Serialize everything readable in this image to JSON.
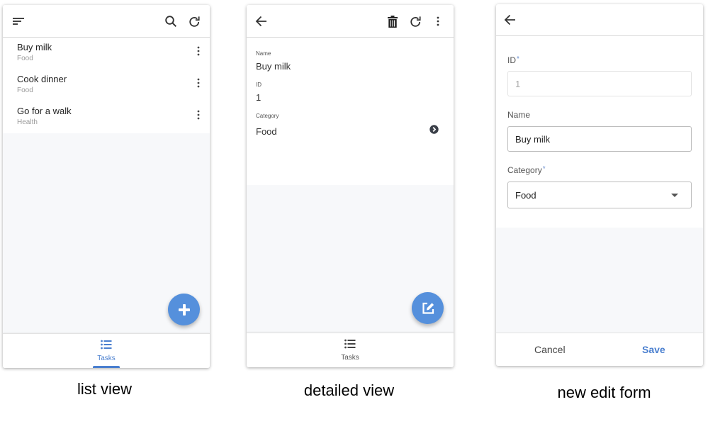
{
  "colors": {
    "accent": "#5590dc",
    "tab_active": "#4a7fcf"
  },
  "list_view": {
    "caption": "list view",
    "toolbar": {
      "icons": [
        "sort-icon",
        "search-icon",
        "refresh-icon"
      ]
    },
    "items": [
      {
        "title": "Buy milk",
        "category": "Food"
      },
      {
        "title": "Cook dinner",
        "category": "Food"
      },
      {
        "title": "Go for a walk",
        "category": "Health"
      }
    ],
    "fab_icon": "plus-icon",
    "bottom_nav": {
      "tab_label": "Tasks",
      "tab_icon": "list-icon",
      "active": true
    }
  },
  "detail_view": {
    "caption": "detailed view",
    "toolbar": {
      "icons": [
        "back-arrow-icon",
        "trash-icon",
        "refresh-icon",
        "more-vertical-icon"
      ]
    },
    "fields": [
      {
        "label": "Name",
        "value": "Buy milk"
      },
      {
        "label": "ID",
        "value": "1"
      },
      {
        "label": "Category",
        "value": "Food"
      }
    ],
    "fab_icon": "edit-icon",
    "bottom_nav": {
      "tab_label": "Tasks",
      "tab_icon": "list-icon",
      "active": false
    }
  },
  "edit_form": {
    "caption": "new edit form",
    "toolbar": {
      "icons": [
        "back-arrow-icon"
      ]
    },
    "id_field": {
      "label": "ID",
      "required_mark": "*",
      "value": "1",
      "disabled": true
    },
    "name_field": {
      "label": "Name",
      "value": "Buy milk"
    },
    "category_field": {
      "label": "Category",
      "required_mark": "*",
      "value": "Food"
    },
    "actions": {
      "cancel": "Cancel",
      "save": "Save"
    }
  }
}
